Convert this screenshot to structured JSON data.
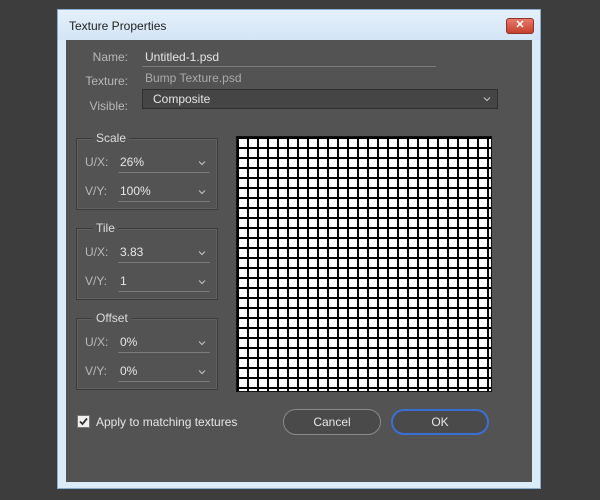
{
  "window": {
    "title": "Texture Properties",
    "close_glyph": "✕"
  },
  "fields": {
    "name_label": "Name:",
    "name_value": "Untitled-1.psd",
    "texture_label": "Texture:",
    "texture_value": "Bump Texture.psd",
    "visible_label": "Visible:",
    "visible_value": "Composite"
  },
  "groups": {
    "scale": {
      "title": "Scale",
      "ux_label": "U/X:",
      "ux_value": "26%",
      "vy_label": "V/Y:",
      "vy_value": "100%"
    },
    "tile": {
      "title": "Tile",
      "ux_label": "U/X:",
      "ux_value": "3.83",
      "vy_label": "V/Y:",
      "vy_value": "1"
    },
    "offset": {
      "title": "Offset",
      "ux_label": "U/X:",
      "ux_value": "0%",
      "vy_label": "V/Y:",
      "vy_value": "0%"
    }
  },
  "footer": {
    "checkbox_label": "Apply to matching textures",
    "checkbox_checked": true,
    "cancel_label": "Cancel",
    "ok_label": "OK"
  },
  "icons": {
    "close": "close-icon",
    "dropdown": "chevron-down-icon",
    "check": "checkmark-icon"
  },
  "colors": {
    "panel": "#535353",
    "primary_border": "#3b6fd6",
    "close_button": "#c4412f"
  }
}
